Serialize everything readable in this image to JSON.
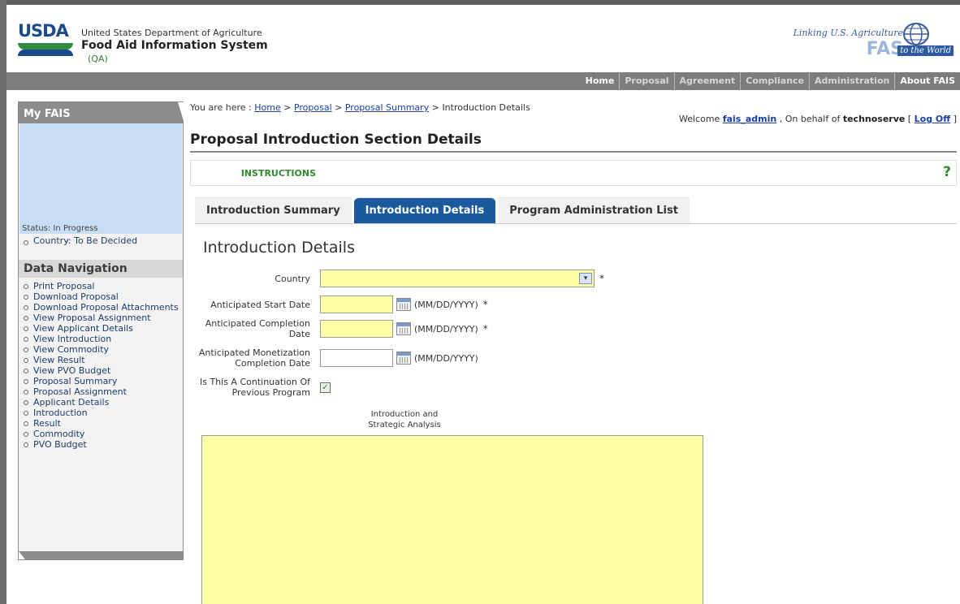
{
  "header": {
    "agency_abbr": "USDA",
    "department": "United States Department of Agriculture",
    "system_name": "Food Aid Information System",
    "environment": "(QA)",
    "fas_tagline": "Linking U.S. Agriculture",
    "fas_word": "FAS",
    "fas_world": "to the World"
  },
  "nav": {
    "items": [
      "Home",
      "Proposal",
      "Agreement",
      "Compliance",
      "Administration",
      "About FAIS"
    ]
  },
  "sidebar": {
    "title": "My FAIS",
    "partial_status": "Status: In Progress",
    "country_line": "Country: To Be Decided",
    "section_title": "Data Navigation",
    "items": [
      "Print Proposal",
      "Download Proposal",
      "Download Proposal Attachments",
      "View Proposal Assignment",
      "View Applicant Details",
      "View Introduction",
      "View Commodity",
      "View Result",
      "View PVO Budget",
      "Proposal Summary",
      "Proposal Assignment",
      "Applicant Details",
      "Introduction",
      "Result",
      "Commodity",
      "PVO Budget"
    ]
  },
  "breadcrumb": {
    "prefix": "You are here : ",
    "links": [
      "Home",
      "Proposal",
      "Proposal Summary"
    ],
    "current": "Introduction Details",
    "sep": " > "
  },
  "welcome": {
    "prefix": "Welcome ",
    "user": "fais_admin",
    "middle": " , On behalf of ",
    "org": "technoserve",
    "logoff_open": " [ ",
    "logoff": "Log Off",
    "logoff_close": " ]"
  },
  "page_title": "Proposal Introduction Section Details",
  "instructions": {
    "label": "INSTRUCTIONS",
    "help": "?"
  },
  "tabs": [
    {
      "label": "Introduction Summary",
      "active": false
    },
    {
      "label": "Introduction Details",
      "active": true
    },
    {
      "label": "Program Administration List",
      "active": false
    }
  ],
  "section_title": "Introduction Details",
  "form": {
    "country_label": "Country",
    "start_label": "Anticipated Start Date",
    "completion_label": "Anticipated Completion Date",
    "monetization_label": "Anticipated Monetization Completion Date",
    "continuation_label": "Is This A Continuation Of Previous Program",
    "date_hint": "(MM/DD/YYYY)",
    "required_mark": "*",
    "textarea_label": "Introduction and Strategic Analysis",
    "continuation_checked": true
  }
}
